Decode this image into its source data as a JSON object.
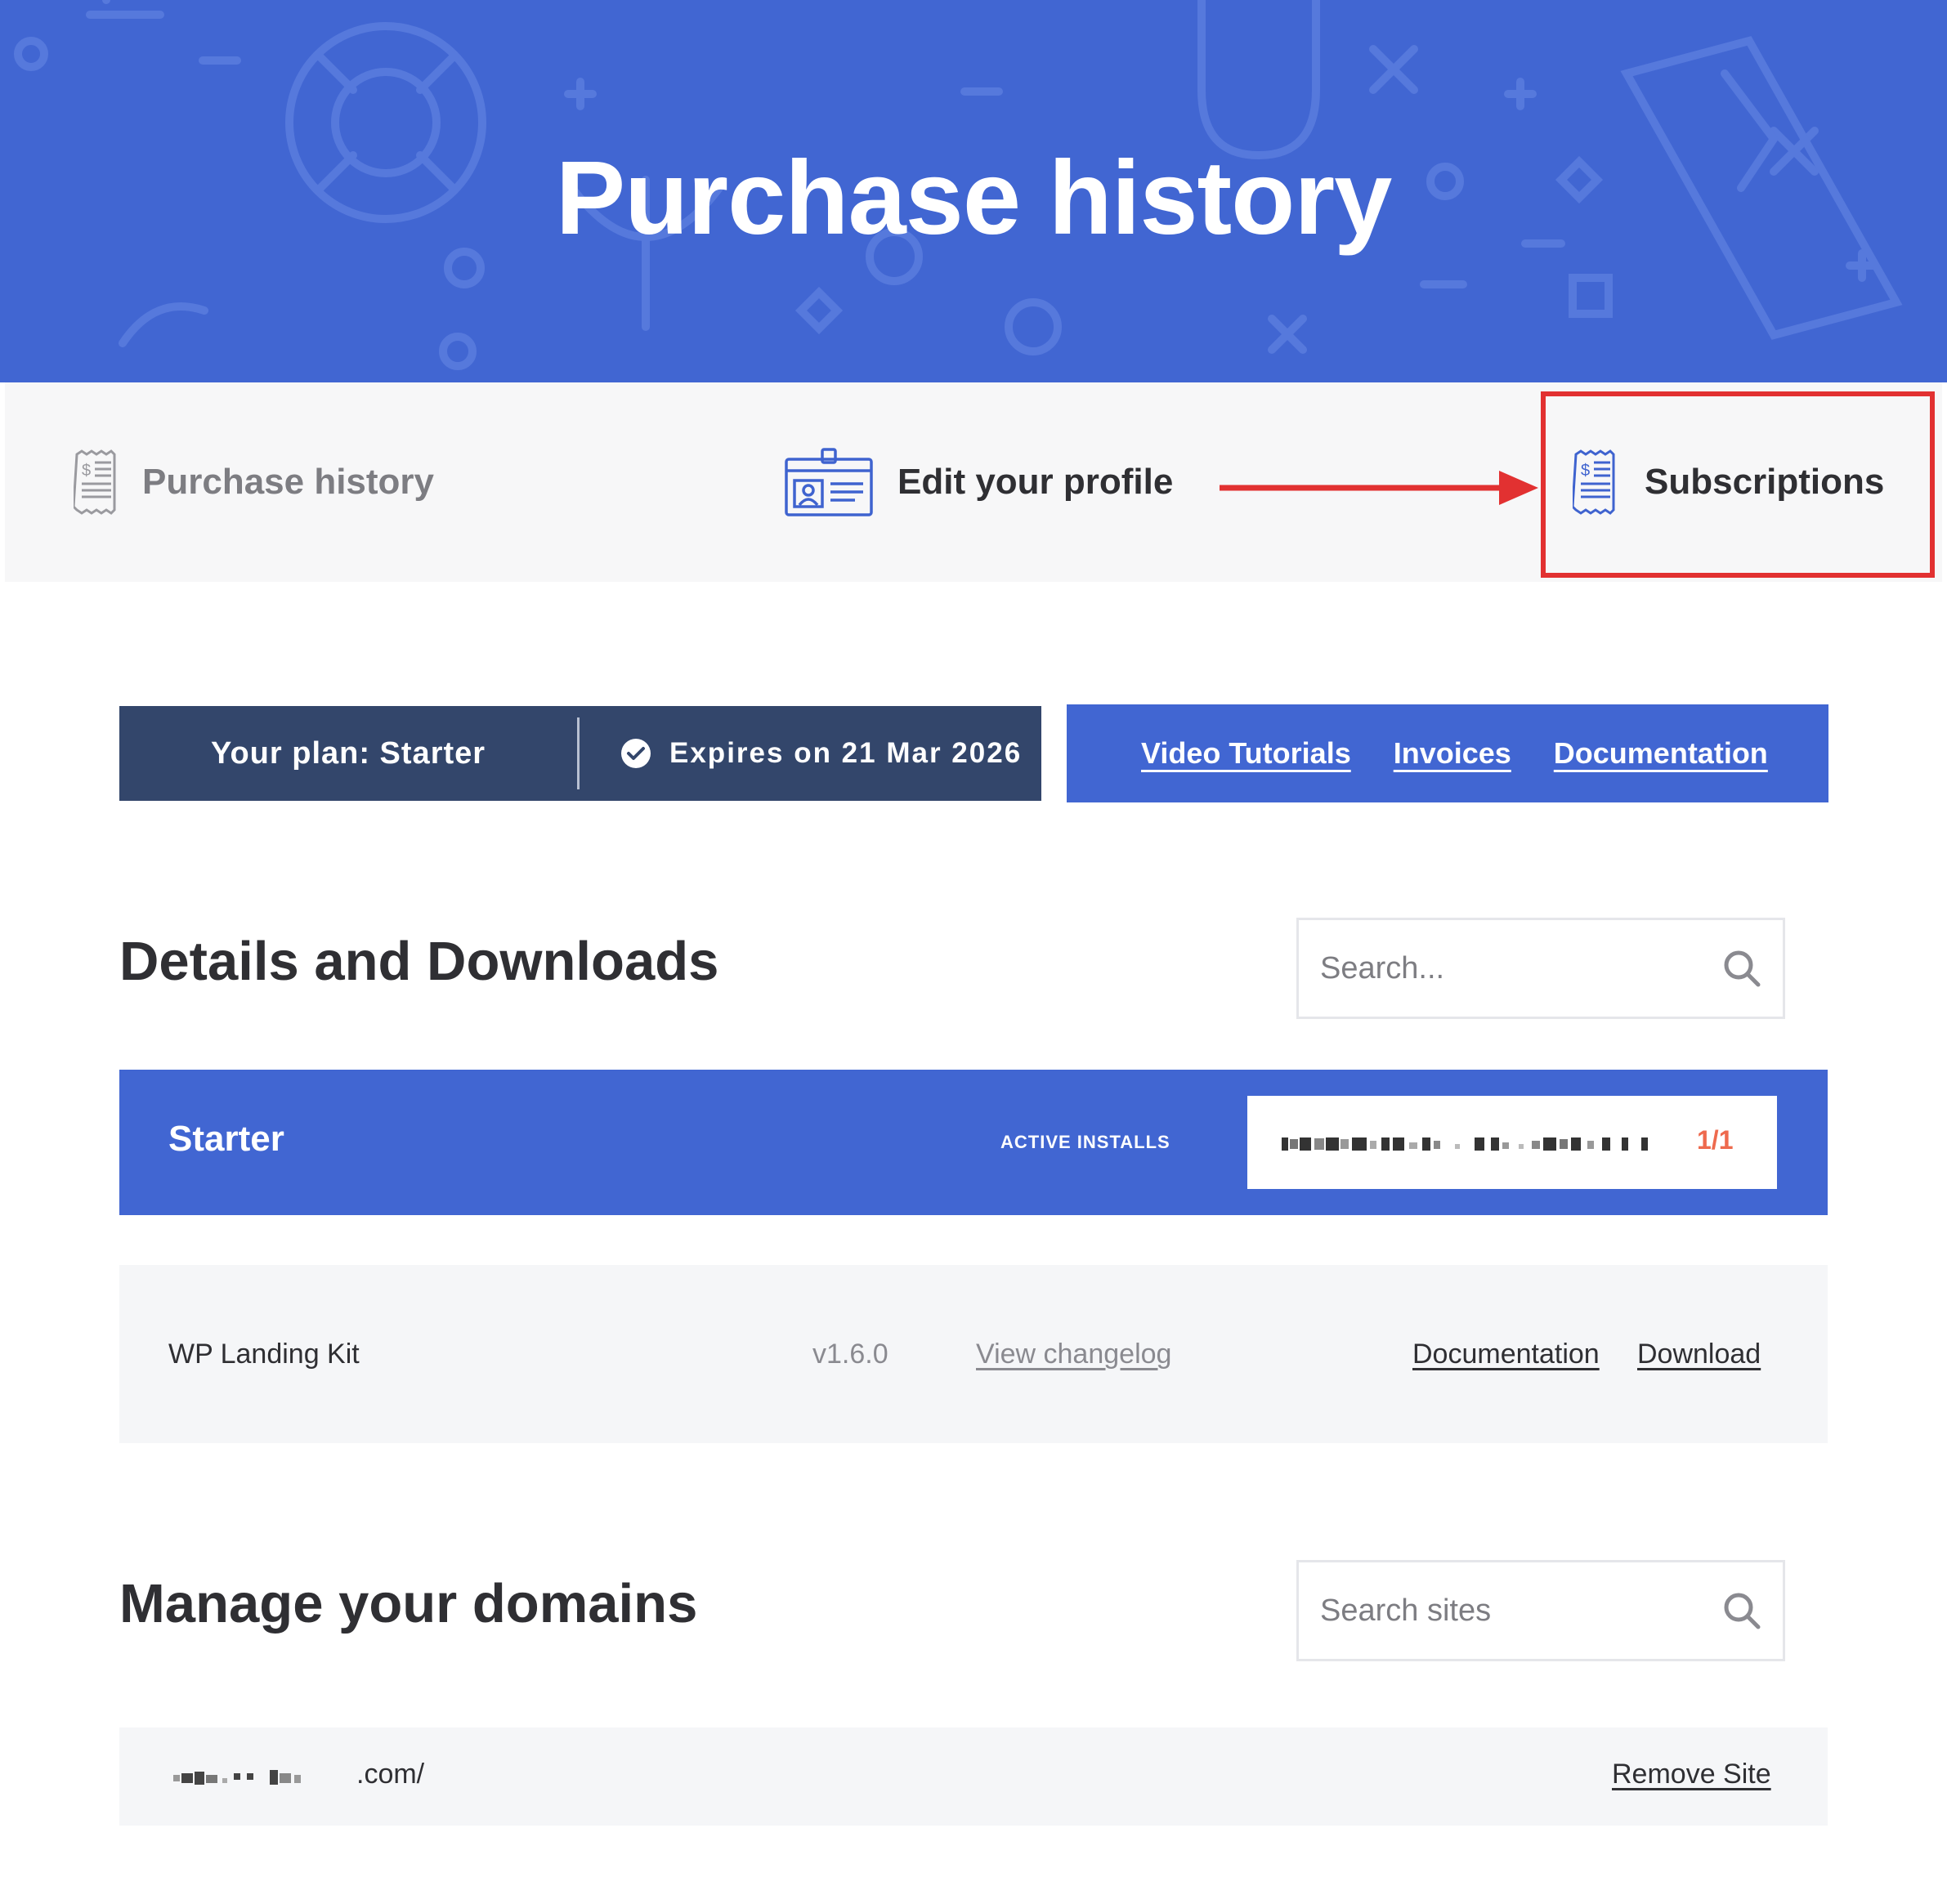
{
  "hero": {
    "title": "Purchase history"
  },
  "tabs": [
    {
      "label": "Purchase history",
      "icon": "receipt-icon"
    },
    {
      "label": "Edit your profile",
      "icon": "id-card-icon"
    },
    {
      "label": "Subscriptions",
      "icon": "receipt-icon"
    }
  ],
  "plan": {
    "name": "Your plan: Starter",
    "expires": "Expires on 21 Mar 2026"
  },
  "quick_links": [
    "Video Tutorials",
    "Invoices",
    "Documentation"
  ],
  "details": {
    "heading": "Details and Downloads",
    "search_placeholder": "Search..."
  },
  "product": {
    "name": "Starter",
    "active_installs_label": "ACTIVE INSTALLS",
    "installs_count": "1/1",
    "item": {
      "name": "WP Landing Kit",
      "version": "v1.6.0",
      "changelog_link": "View changelog",
      "documentation_link": "Documentation",
      "download_link": "Download"
    }
  },
  "domains": {
    "heading": "Manage your domains",
    "search_placeholder": "Search sites",
    "items": [
      {
        "domain_suffix": ".com/",
        "remove_label": "Remove Site"
      }
    ]
  },
  "colors": {
    "brand_blue": "#4166d2",
    "plan_navy": "#33466b",
    "highlight_red": "#e23131",
    "count_orange": "#ee6a4e"
  }
}
